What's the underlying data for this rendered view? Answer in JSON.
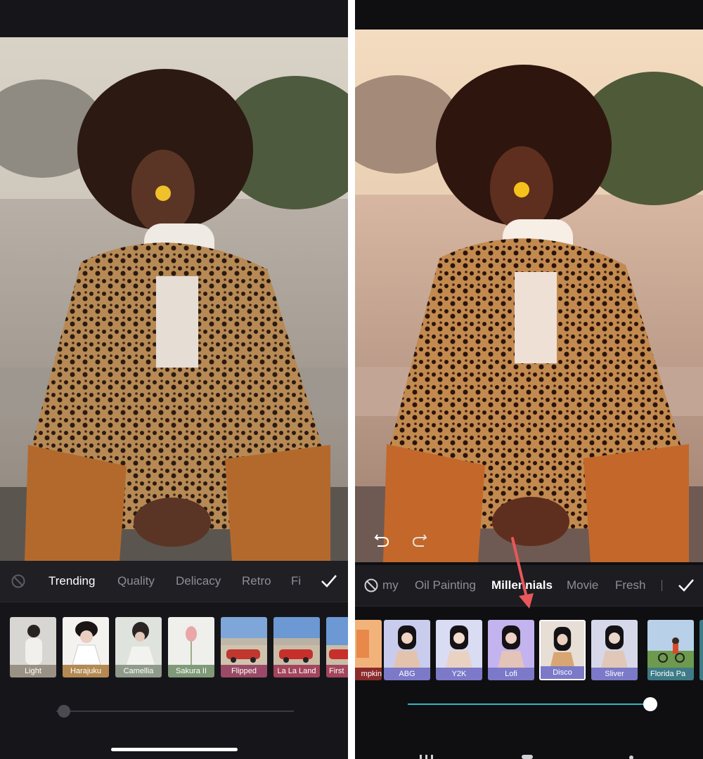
{
  "left": {
    "categories": [
      "Trending",
      "Quality",
      "Delicacy",
      "Retro",
      "Fi"
    ],
    "active_category": "Trending",
    "filters": [
      {
        "label": "Light",
        "color": "#9a9185"
      },
      {
        "label": "Harajuku",
        "color": "#b48a52"
      },
      {
        "label": "Camellia",
        "color": "#8f9a8a"
      },
      {
        "label": "Sakura II",
        "color": "#7f9a78"
      },
      {
        "label": "Flipped",
        "color": "#9a4a66"
      },
      {
        "label": "La La Land",
        "color": "#a3455c"
      },
      {
        "label": "First",
        "color": "#a3455c"
      }
    ],
    "slider_value": 0.02
  },
  "right": {
    "categories": [
      "my",
      "Oil Painting",
      "Millennials",
      "Movie",
      "Fresh"
    ],
    "active_category": "Millennials",
    "filters": [
      {
        "label": "mpkin",
        "color": "#8a2a2a"
      },
      {
        "label": "ABG",
        "color": "#7b79c8"
      },
      {
        "label": "Y2K",
        "color": "#7b79c8"
      },
      {
        "label": "Lofi",
        "color": "#7b79c8"
      },
      {
        "label": "Disco",
        "color": "#7b79c8"
      },
      {
        "label": "Sliver",
        "color": "#7b79c8"
      },
      {
        "label": "Florida Pa",
        "color": "#3e7b86"
      }
    ],
    "selected_filter": "Disco",
    "slider_value": 1.0,
    "accent": "#2fb8c8",
    "arrow_color": "#e8575a"
  }
}
